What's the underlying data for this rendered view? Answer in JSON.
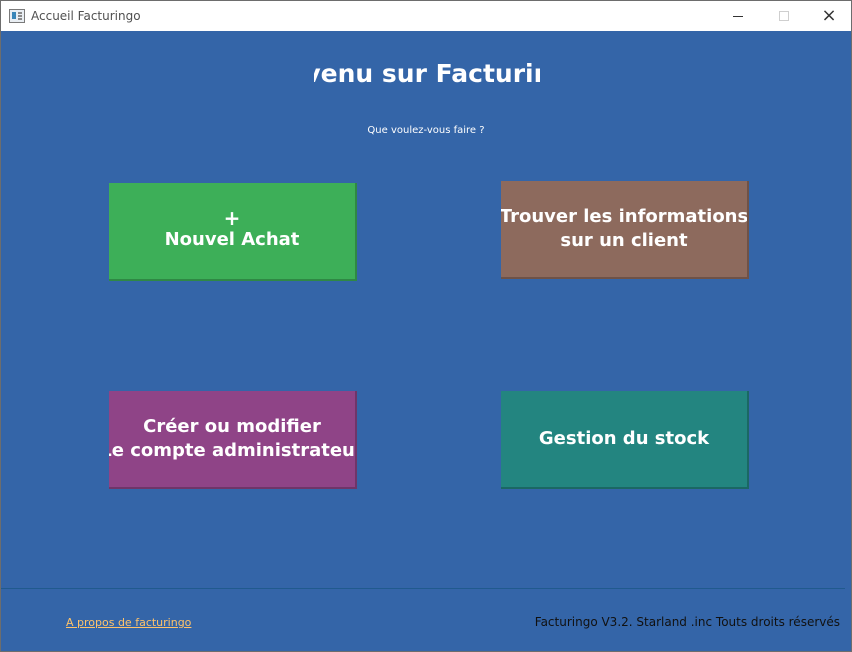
{
  "window": {
    "title": "Accueil Facturingo",
    "controls": {
      "minimize": "minimize",
      "maximize": "maximize",
      "close": "close"
    }
  },
  "header": {
    "welcome": "Bienvenu sur Facturingo",
    "question": "Que voulez-vous faire ?"
  },
  "actions": {
    "new_purchase_plus": "+",
    "new_purchase_label": "Nouvel Achat",
    "client_info_line1": "Trouver les informations",
    "client_info_line2": "sur un client",
    "admin_line1": "Créer ou modifier",
    "admin_line2": "Le compte administrateur",
    "stock_label": "Gestion du stock"
  },
  "footer": {
    "about_link": "A propos de facturingo",
    "copyright": "Facturingo V3.2.  Starland .inc Touts droits réservés"
  },
  "colors": {
    "background": "#3465a8",
    "new_purchase": "#3daf58",
    "client_info": "#8d6a5d",
    "admin": "#8f4487",
    "stock": "#238580",
    "link": "#ffc36a"
  },
  "icons": {
    "app": "window-icon",
    "plus": "plus-icon",
    "minimize": "minimize-icon",
    "maximize": "maximize-icon",
    "close": "close-icon"
  }
}
